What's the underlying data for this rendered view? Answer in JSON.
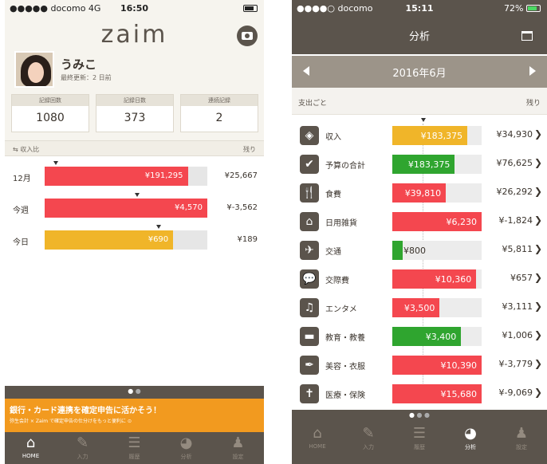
{
  "home": {
    "status": {
      "carrier": "●●●●● docomo  4G",
      "time": "16:50"
    },
    "logo": "zaim",
    "user": {
      "name": "うみこ",
      "last_update": "最終更新：2 日前"
    },
    "stats": [
      {
        "label": "記録回数",
        "value": "1080"
      },
      {
        "label": "記録日数",
        "value": "373"
      },
      {
        "label": "連続記録",
        "value": "2"
      }
    ],
    "section": {
      "left": "⇆  収入比",
      "right": "残り"
    },
    "rows": [
      {
        "label": "12月",
        "value": "¥191,295",
        "remaining": "¥25,667",
        "fraction": 0.88,
        "color": "#f4474f",
        "marker": 0.07
      },
      {
        "label": "今週",
        "value": "¥4,570",
        "remaining": "¥-3,562",
        "fraction": 1.0,
        "color": "#f4474f",
        "marker": 0.57
      },
      {
        "label": "今日",
        "value": "¥690",
        "remaining": "¥189",
        "fraction": 0.79,
        "color": "#f0b529",
        "marker": 0.7
      }
    ],
    "banner": {
      "title": "銀行・カード連携を確定申告に活かそう！",
      "subtitle": "弥生会計 × Zaim で確定申告の仕分けをもっと便利に ⊙"
    },
    "tabs": [
      {
        "label": "HOME",
        "icon": "⌂"
      },
      {
        "label": "入力",
        "icon": "✎"
      },
      {
        "label": "履歴",
        "icon": "☰"
      },
      {
        "label": "分析",
        "icon": "◕"
      },
      {
        "label": "設定",
        "icon": "♟"
      }
    ]
  },
  "analysis": {
    "status": {
      "carrier": "●●●●○ docomo",
      "time": "15:11",
      "battery": "72%"
    },
    "title": "分析",
    "month": "2016年6月",
    "section": {
      "left": "支出ごと",
      "right": "残り"
    },
    "rows": [
      {
        "icon": "◈",
        "label": "収入",
        "value": "¥183,375",
        "remaining": "¥34,930",
        "fraction": 0.84,
        "color": "#f0b529"
      },
      {
        "icon": "✔",
        "label": "予算の合計",
        "value": "¥183,375",
        "remaining": "¥76,625",
        "fraction": 0.7,
        "color": "#2fa52f"
      },
      {
        "icon": "🍴",
        "label": "食費",
        "value": "¥39,810",
        "remaining": "¥26,292",
        "fraction": 0.6,
        "color": "#f4474f"
      },
      {
        "icon": "⌂",
        "label": "日用雑貨",
        "value": "¥6,230",
        "remaining": "¥-1,824",
        "fraction": 1.0,
        "color": "#f4474f"
      },
      {
        "icon": "✈",
        "label": "交通",
        "value": "¥800",
        "remaining": "¥5,811",
        "fraction": 0.12,
        "color": "#2fa52f"
      },
      {
        "icon": "💬",
        "label": "交際費",
        "value": "¥10,360",
        "remaining": "¥657",
        "fraction": 0.94,
        "color": "#f4474f"
      },
      {
        "icon": "♫",
        "label": "エンタメ",
        "value": "¥3,500",
        "remaining": "¥3,111",
        "fraction": 0.53,
        "color": "#f4474f"
      },
      {
        "icon": "▬",
        "label": "教育・教養",
        "value": "¥3,400",
        "remaining": "¥1,006",
        "fraction": 0.77,
        "color": "#2fa52f"
      },
      {
        "icon": "✒",
        "label": "美容・衣服",
        "value": "¥10,390",
        "remaining": "¥-3,779",
        "fraction": 1.0,
        "color": "#f4474f"
      },
      {
        "icon": "✝",
        "label": "医療・保険",
        "value": "¥15,680",
        "remaining": "¥-9,069",
        "fraction": 1.0,
        "color": "#f4474f"
      }
    ],
    "tabs": [
      {
        "label": "HOME",
        "icon": "⌂"
      },
      {
        "label": "入力",
        "icon": "✎"
      },
      {
        "label": "履歴",
        "icon": "☰"
      },
      {
        "label": "分析",
        "icon": "◕"
      },
      {
        "label": "設定",
        "icon": "♟"
      }
    ]
  }
}
